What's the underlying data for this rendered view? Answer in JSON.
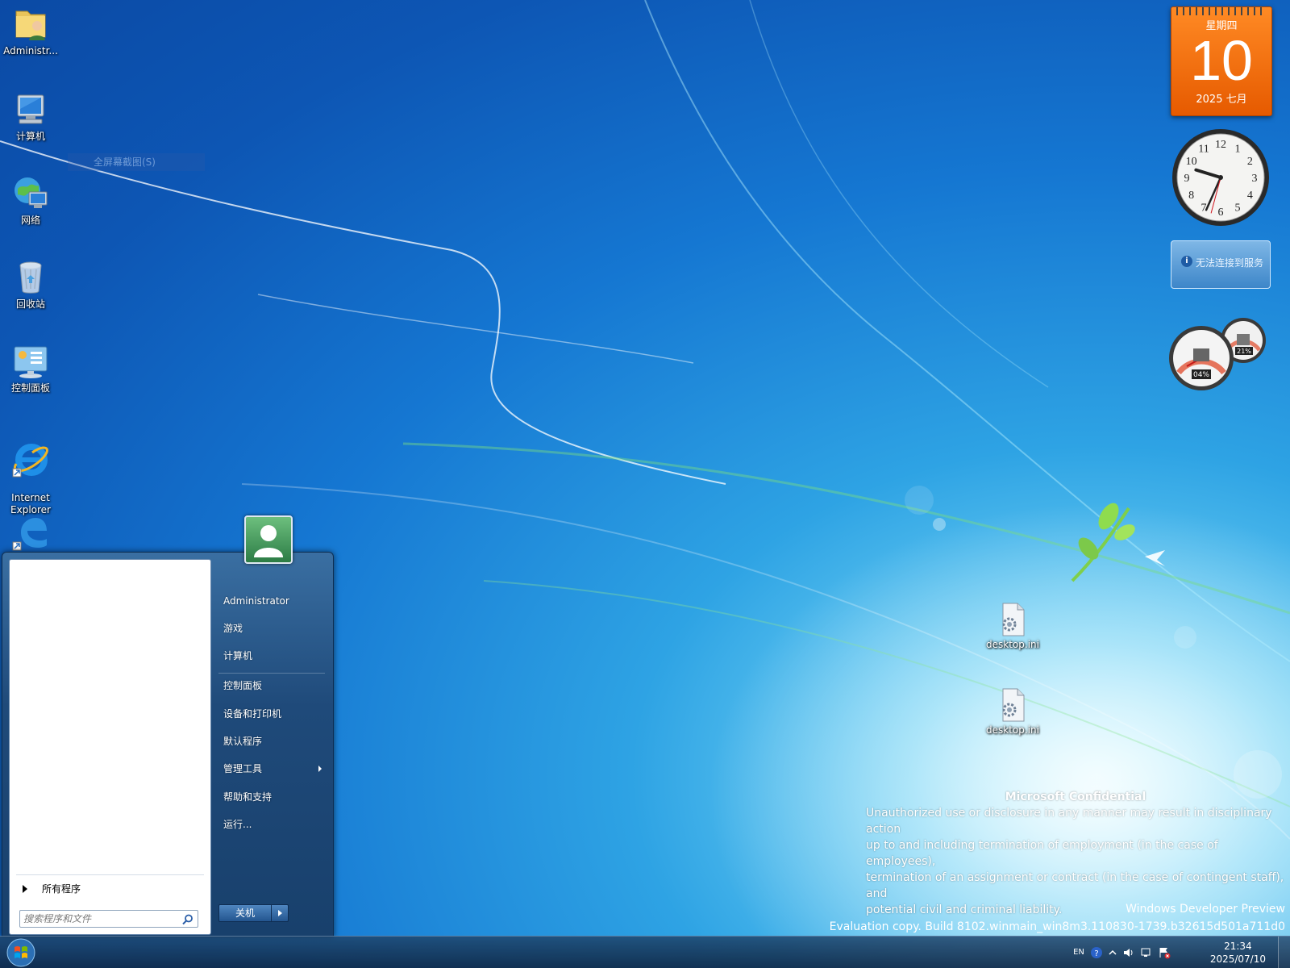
{
  "desktop_icons": [
    {
      "label": "Administr...",
      "icon": "user-folder-icon"
    },
    {
      "label": "计算机",
      "icon": "computer-icon"
    },
    {
      "label": "网络",
      "icon": "network-icon"
    },
    {
      "label": "回收站",
      "icon": "recycle-bin-icon"
    },
    {
      "label": "控制面板",
      "icon": "control-panel-icon"
    },
    {
      "label": "Internet\nExplorer",
      "icon": "internet-explorer-icon"
    },
    {
      "label": "",
      "icon": "edge-icon"
    }
  ],
  "context_ghost": "全屏幕截图(S)",
  "files": [
    {
      "label": "desktop.ini",
      "icon": "ini-file-icon"
    },
    {
      "label": "desktop.ini",
      "icon": "ini-file-icon"
    }
  ],
  "calendar": {
    "weekday": "星期四",
    "day": "10",
    "year_month": "2025 七月"
  },
  "clock_gadget": {
    "hour": 9,
    "minute": 34,
    "numerals": [
      "12",
      "1",
      "2",
      "3",
      "4",
      "5",
      "6",
      "7",
      "8",
      "9",
      "10",
      "11"
    ]
  },
  "weather": {
    "message": "无法连接到服务"
  },
  "cpu_meter": {
    "cpu": "04%",
    "memory": "21%",
    "cpu_value": 4,
    "memory_value": 21
  },
  "confidential": {
    "title": "Microsoft Confidential",
    "lines": [
      "Unauthorized use or disclosure in any manner may result in disciplinary action",
      "up to and including termination of employment (in the case of employees),",
      "termination of an assignment or contract (in the case of contingent staff), and",
      "potential civil and criminal liability."
    ]
  },
  "watermark": {
    "line1": "Windows Developer Preview",
    "line2": "Evaluation copy. Build 8102.winmain_win8m3.110830-1739.b32615d501a711d0"
  },
  "start_menu": {
    "all_programs": "所有程序",
    "search_placeholder": "搜索程序和文件",
    "right_items": [
      {
        "label": "Administrator"
      },
      {
        "label": "游戏"
      },
      {
        "label": "计算机"
      },
      {
        "label": "控制面板"
      },
      {
        "label": "设备和打印机"
      },
      {
        "label": "默认程序"
      },
      {
        "label": "管理工具",
        "submenu": true
      },
      {
        "label": "帮助和支持"
      },
      {
        "label": "运行..."
      }
    ],
    "shutdown_label": "关机"
  },
  "taskbar": {
    "lang": "EN",
    "time": "21:34",
    "date": "2025/07/10"
  },
  "colors": {
    "accent": "#1577d2",
    "calendar": "#f26a0a"
  }
}
